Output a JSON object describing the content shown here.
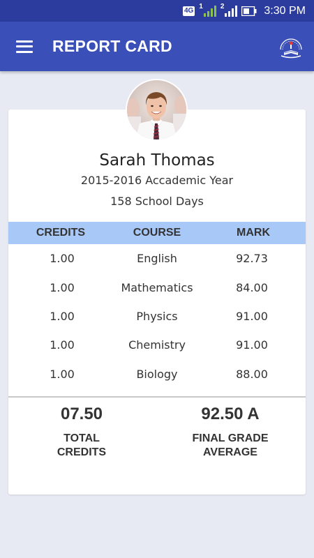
{
  "status_bar": {
    "network": "4G",
    "sim1": "1",
    "sim2": "2",
    "time": "3:30 PM"
  },
  "app_bar": {
    "title": "REPORT CARD",
    "menu_icon": "hamburger-menu-icon",
    "logo_icon": "school-crest-logo"
  },
  "student": {
    "name": "Sarah Thomas",
    "academic_year": "2015-2016 Accademic Year",
    "school_days": "158 School Days"
  },
  "table": {
    "headers": {
      "credits": "CREDITS",
      "course": "COURSE",
      "mark": "MARK"
    },
    "rows": [
      {
        "credits": "1.00",
        "course": "English",
        "mark": "92.73"
      },
      {
        "credits": "1.00",
        "course": "Mathematics",
        "mark": "84.00"
      },
      {
        "credits": "1.00",
        "course": "Physics",
        "mark": "91.00"
      },
      {
        "credits": "1.00",
        "course": "Chemistry",
        "mark": "91.00"
      },
      {
        "credits": "1.00",
        "course": "Biology",
        "mark": "88.00"
      }
    ]
  },
  "summary": {
    "total_credits_value": "07.50",
    "total_credits_label_1": "TOTAL",
    "total_credits_label_2": "CREDITS",
    "final_grade_value": "92.50 A",
    "final_grade_label_1": "FINAL GRADE",
    "final_grade_label_2": "AVERAGE"
  },
  "colors": {
    "status_bar": "#2c3c9e",
    "app_bar": "#3a50b8",
    "table_header": "#a8c8f8",
    "page_background": "#e8eaf3"
  }
}
